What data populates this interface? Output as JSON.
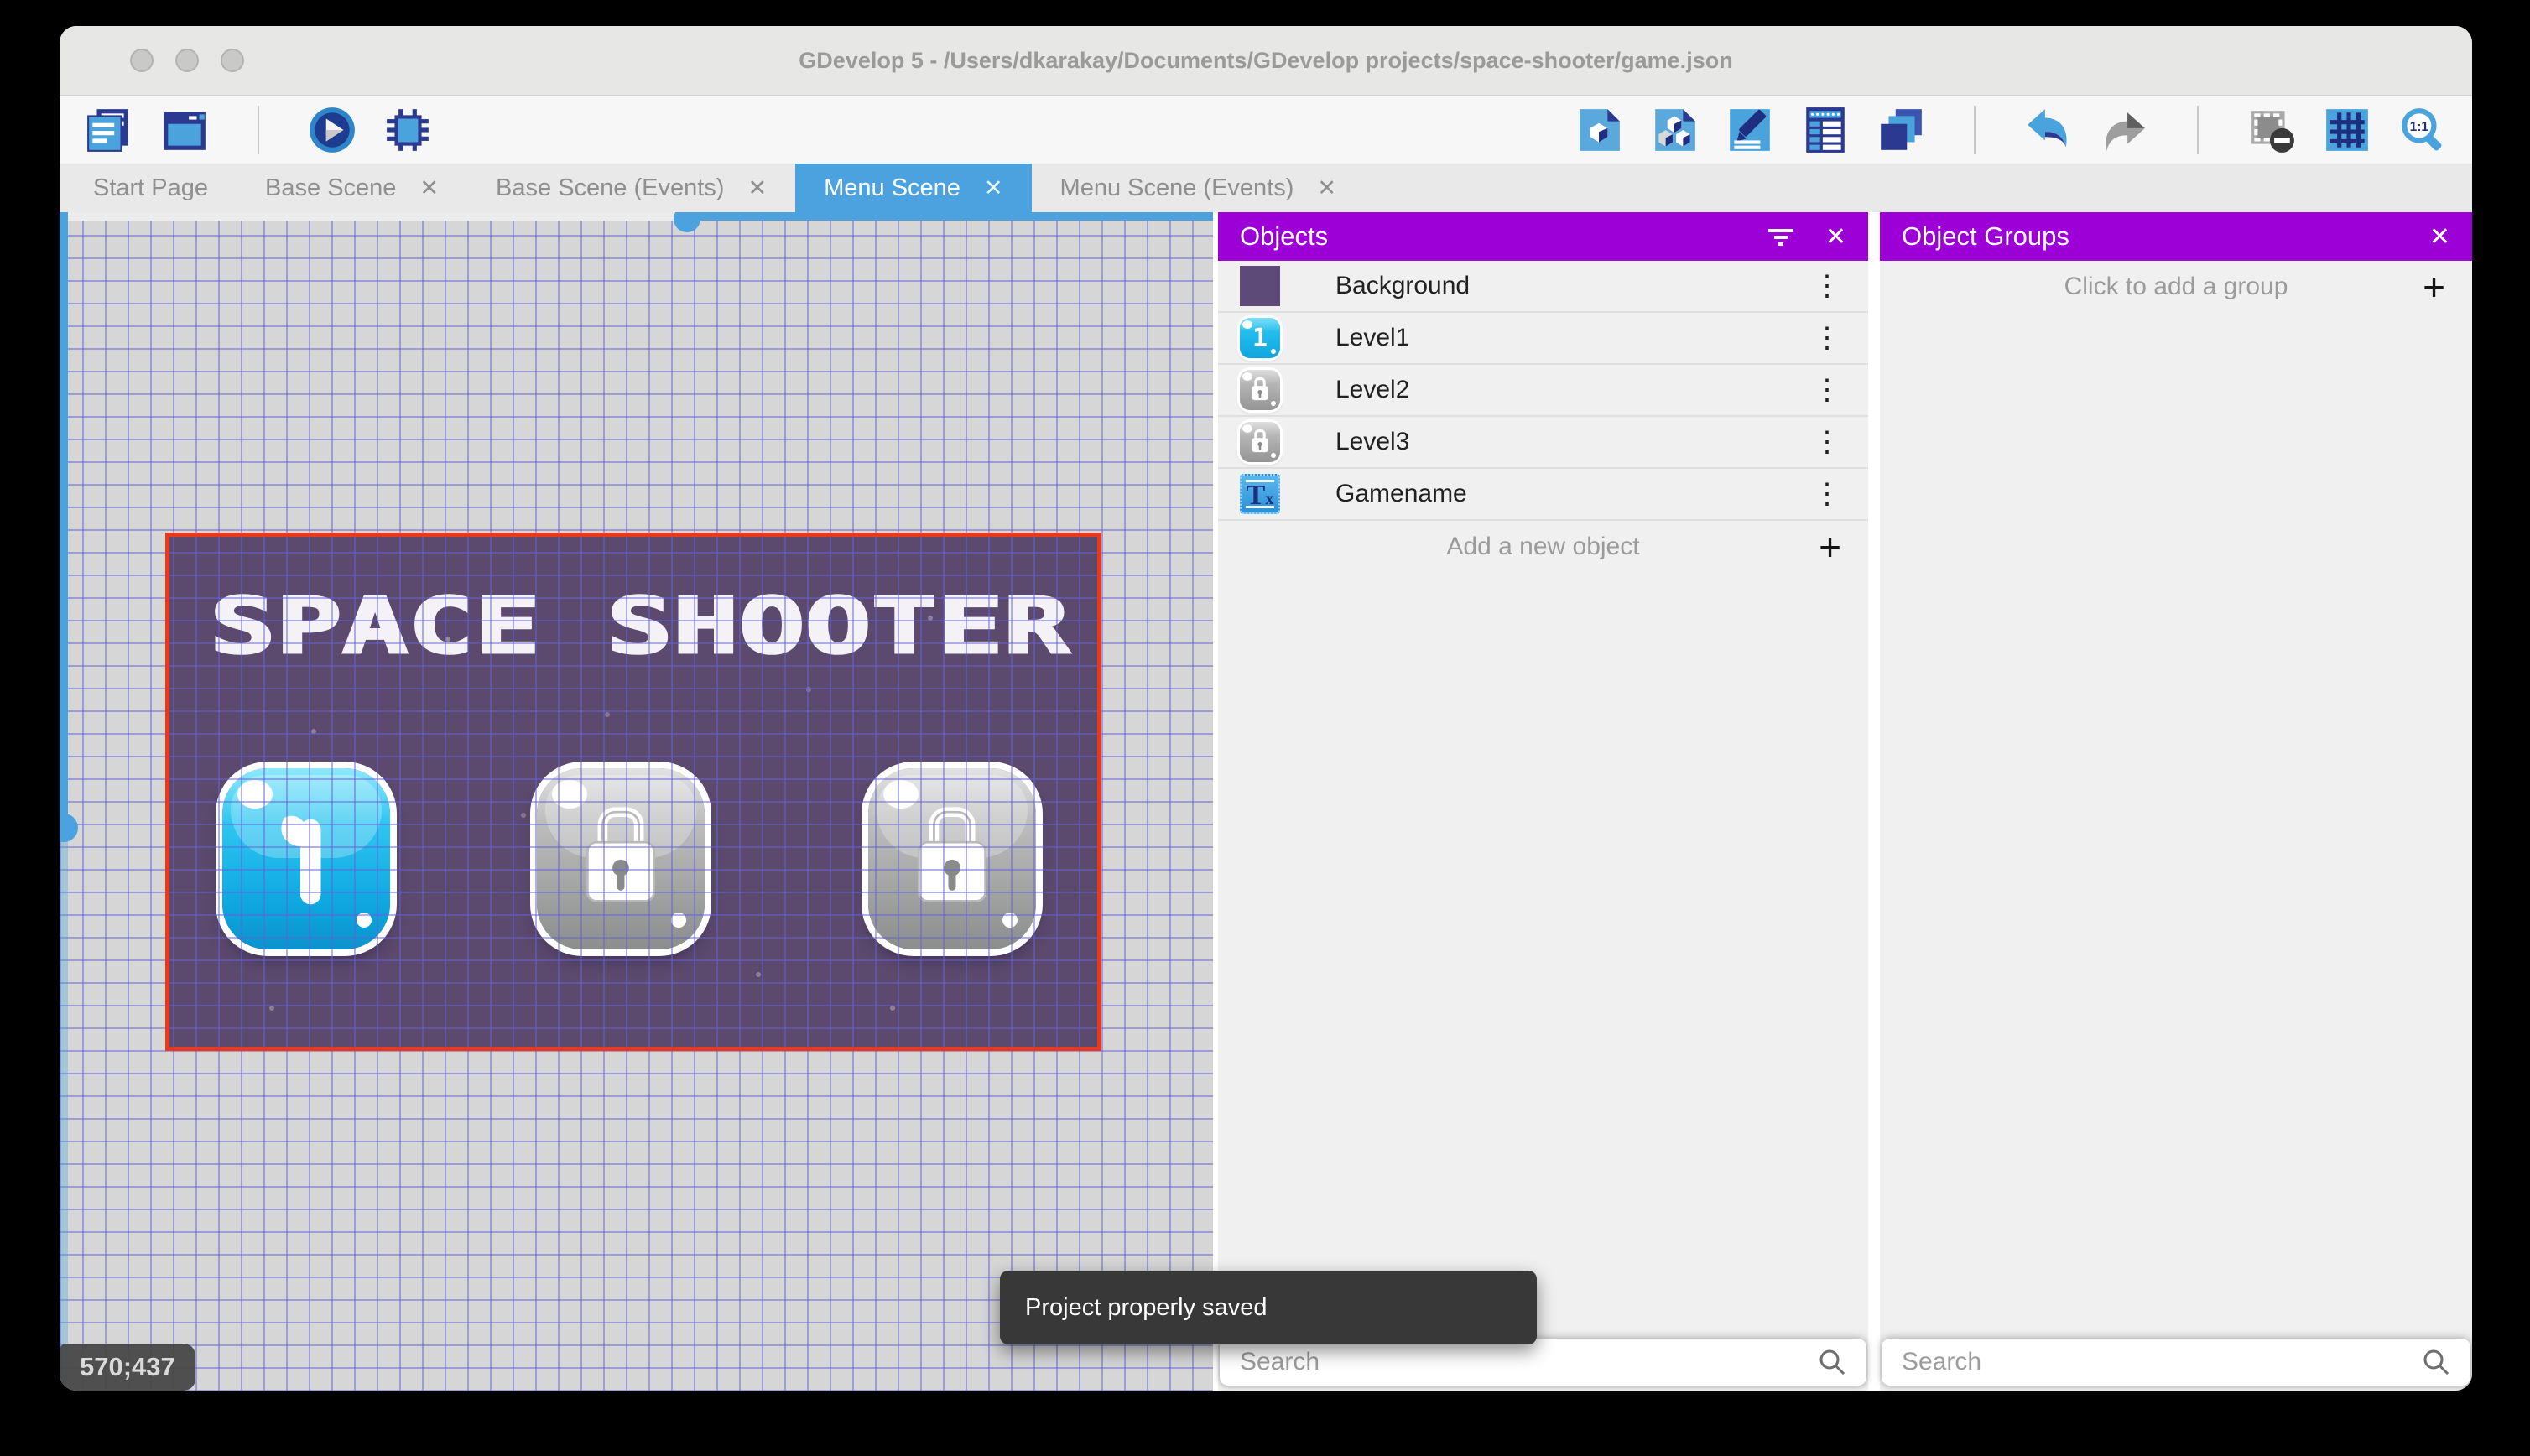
{
  "window": {
    "title": "GDevelop 5 - /Users/dkarakay/Documents/GDevelop projects/space-shooter/game.json"
  },
  "icons": {
    "close": "✕",
    "plus": "+",
    "kebab": "⋮",
    "zoom_ratio": "1:1"
  },
  "toolbar": {
    "left_icons": [
      "project-manager",
      "start-page-window",
      "preview-play",
      "debugger-bug"
    ],
    "right_icons": [
      "objects-editor",
      "object-groups-editor",
      "properties",
      "instances-list",
      "layers-editor",
      "undo",
      "redo",
      "window-mask",
      "grid",
      "zoom-1-1"
    ]
  },
  "tabs": [
    {
      "label": "Start Page",
      "active": false,
      "closable": false
    },
    {
      "label": "Base Scene",
      "active": false,
      "closable": true
    },
    {
      "label": "Base Scene (Events)",
      "active": false,
      "closable": true
    },
    {
      "label": "Menu Scene",
      "active": true,
      "closable": true
    },
    {
      "label": "Menu Scene (Events)",
      "active": false,
      "closable": true
    }
  ],
  "canvas": {
    "cursor_coordinates": "570;437"
  },
  "scene": {
    "title": "SPACE SHOOTER",
    "buttons": [
      {
        "label": "1",
        "state": "unlocked",
        "color": "#1FB9EC"
      },
      {
        "label": "",
        "state": "locked",
        "color": "#A9A9A9"
      },
      {
        "label": "",
        "state": "locked",
        "color": "#A9A9A9"
      }
    ],
    "background_color": "#5B4A6E",
    "mask_border_color": "#E8391D"
  },
  "objects_panel": {
    "title": "Objects",
    "items": [
      {
        "name": "Background",
        "thumb": "purple-swatch"
      },
      {
        "name": "Level1",
        "thumb": "blue-button-1"
      },
      {
        "name": "Level2",
        "thumb": "gray-lock-button"
      },
      {
        "name": "Level3",
        "thumb": "gray-lock-button"
      },
      {
        "name": "Gamename",
        "thumb": "text-object"
      }
    ],
    "add_label": "Add a new object",
    "search_placeholder": "Search"
  },
  "groups_panel": {
    "title": "Object Groups",
    "empty_label": "Click to add a group",
    "search_placeholder": "Search"
  },
  "toast": {
    "message": "Project properly saved"
  },
  "colors": {
    "panel_header": "#9C00D6",
    "active_tab": "#4BA2DE",
    "scene_background": "#5B4A6E",
    "mask_border": "#E8391D",
    "canvas_background": "#D6D6D6"
  }
}
